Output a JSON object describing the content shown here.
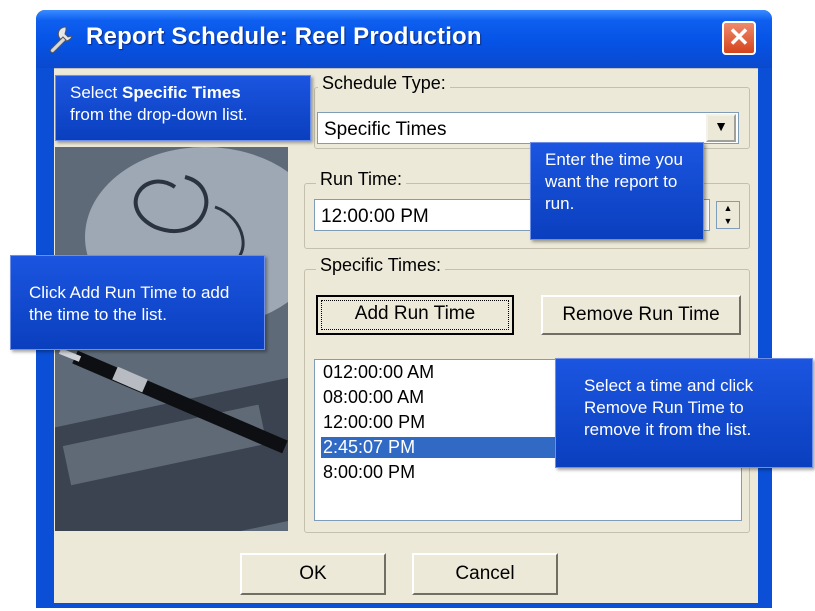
{
  "window": {
    "title": "Report Schedule: Reel Production",
    "close_glyph": "✕"
  },
  "schedule_type": {
    "label": "Schedule Type:",
    "value": "Specific Times",
    "dropdown_glyph": "▼"
  },
  "run_time": {
    "label": "Run Time:",
    "value": "12:00:00 PM",
    "spin_up": "▲",
    "spin_down": "▼"
  },
  "specific_times": {
    "label": "Specific Times:",
    "add_button": "Add Run Time",
    "remove_button": "Remove Run Time",
    "items": [
      "012:00:00 AM",
      "08:00:00 AM",
      "12:00:00 PM",
      "2:45:07 PM",
      "8:00:00 PM"
    ],
    "selected_index": 3
  },
  "footer": {
    "ok": "OK",
    "cancel": "Cancel"
  },
  "callouts": {
    "select_prefix": "Select ",
    "select_bold": "Specific Times",
    "select_suffix": "from the drop-down list.",
    "enter_time": "Enter the time you want the report to run.",
    "click_add": "Click Add Run Time to add the time to the list.",
    "select_remove": "Select a time and click Remove Run Time to remove it from the list."
  },
  "colors": {
    "titlebar": "#0653e6",
    "dialog_bg": "#ece9d8",
    "selection": "#316ac5",
    "callout": "#1b55e0"
  }
}
